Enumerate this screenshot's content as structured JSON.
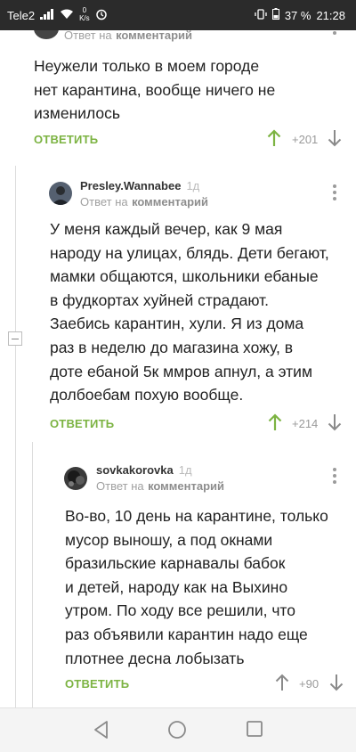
{
  "status_bar": {
    "carrier": "Tele2",
    "speed_value": "0",
    "speed_unit": "K/s",
    "battery": "37 %",
    "time": "21:28"
  },
  "colors": {
    "accent_green": "#7cb342",
    "status_bar_bg": "#2b2b2b",
    "meta_gray": "#a0a0a0"
  },
  "comments": [
    {
      "meta_prefix": "Ответ на",
      "meta_link": "комментарий",
      "text_lines": [
        "Неужели только в моем городе",
        "нет карантина, вообще ничего не",
        "изменилось"
      ],
      "reply_label": "ОТВЕТИТЬ",
      "rating": "+201"
    },
    {
      "author": "Presley.Wannabee",
      "age": "1д",
      "meta_prefix": "Ответ на",
      "meta_link": "комментарий",
      "text_lines": [
        "У меня каждый вечер, как 9 мая",
        "народу на улицах, блядь. Дети бегают,",
        "мамки общаются, школьники ебаные",
        "в фудкортах хуйней страдают.",
        "Заебись карантин, хули. Я из дома",
        "раз в неделю до магазина хожу, в",
        "доте ебаной 5к ммров апнул, а этим",
        "долбоебам похую вообще."
      ],
      "reply_label": "ОТВЕТИТЬ",
      "rating": "+214"
    },
    {
      "author": "sovkakorovka",
      "age": "1д",
      "meta_prefix": "Ответ на",
      "meta_link": "комментарий",
      "text_lines": [
        "Во-во, 10 день на карантине, только",
        "мусор выношу, а под окнами",
        "бразильские карнавалы бабок",
        "и детей, народу как на Выхино",
        "утром. По ходу все решили, что",
        "раз объявили карантин надо еще",
        "плотнее десна лобызать"
      ],
      "reply_label": "ОТВЕТИТЬ",
      "rating": "+90"
    }
  ],
  "icons": {
    "upvote": "arrow-up-icon",
    "downvote": "arrow-down-icon",
    "more": "kebab-menu-icon",
    "collapse": "collapse-thread-icon",
    "nav_back": "triangle-back-icon",
    "nav_home": "circle-home-icon",
    "nav_recents": "square-recents-icon"
  }
}
